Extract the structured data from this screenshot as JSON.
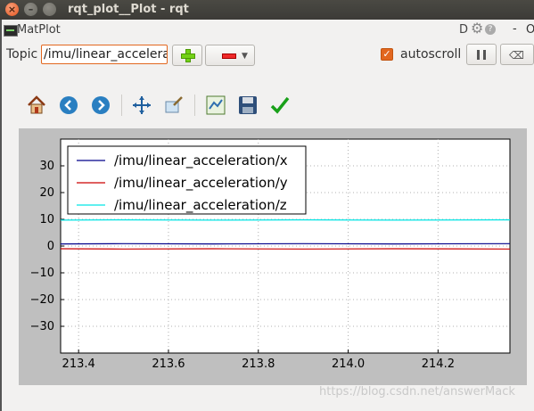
{
  "window": {
    "title": "rqt_plot__Plot - rqt"
  },
  "plugin": {
    "title": "MatPlot",
    "right_d": "D",
    "right_dash": "-",
    "right_o": "O"
  },
  "toolbar_row": {
    "topic_label": "Topic",
    "topic_value": "/imu/linear_accelera",
    "autoscroll_label": "autoscroll",
    "autoscroll_checked": true
  },
  "nav_toolbar": {
    "icons": [
      "home-icon",
      "back-arrow-icon",
      "forward-arrow-icon",
      "pan-icon",
      "zoom-icon",
      "subplots-icon",
      "save-icon",
      "edit-curves-icon"
    ]
  },
  "colors": {
    "accent": "#e2671f",
    "x": "#00008b",
    "y": "#cc0000",
    "z": "#00e5e5"
  },
  "chart_data": {
    "type": "line",
    "x": [
      213.36,
      213.5,
      213.7,
      213.9,
      214.1,
      214.36
    ],
    "series": [
      {
        "name": "/imu/linear_acceleration/x",
        "values": [
          0.8,
          0.9,
          0.8,
          0.9,
          0.8,
          0.9
        ]
      },
      {
        "name": "/imu/linear_acceleration/y",
        "values": [
          -1.0,
          -1.1,
          -1.0,
          -1.1,
          -1.0,
          -1.1
        ]
      },
      {
        "name": "/imu/linear_acceleration/z",
        "values": [
          9.7,
          9.8,
          9.7,
          9.8,
          9.7,
          9.8
        ]
      }
    ],
    "xlim": [
      213.36,
      214.36
    ],
    "ylim": [
      -40,
      40
    ],
    "xticks": [
      "213.4",
      "213.6",
      "213.8",
      "214.0",
      "214.2"
    ],
    "xtick_values": [
      213.4,
      213.6,
      213.8,
      214.0,
      214.2
    ],
    "yticks": [
      "30",
      "20",
      "10",
      "0",
      "−10",
      "−20",
      "−30"
    ],
    "ytick_values": [
      30,
      20,
      10,
      0,
      -10,
      -20,
      -30
    ],
    "grid": true,
    "legend_position": "top-left"
  },
  "watermark": "https://blog.csdn.net/answerMack"
}
